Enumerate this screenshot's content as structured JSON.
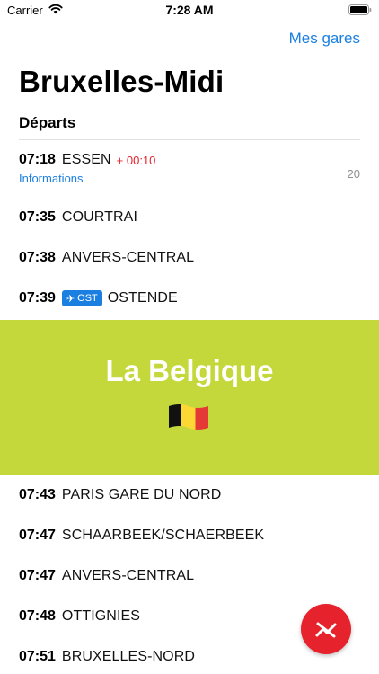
{
  "status_bar": {
    "carrier": "Carrier",
    "time": "7:28 AM"
  },
  "nav": {
    "right_link": "Mes gares"
  },
  "station": {
    "name": "Bruxelles-Midi"
  },
  "section": {
    "title": "Départs"
  },
  "departures": [
    {
      "time": "07:18",
      "destination": "ESSEN",
      "delay": "+ 00:10",
      "platform": "20",
      "info": "Informations"
    },
    {
      "time": "07:35",
      "destination": "COURTRAI"
    },
    {
      "time": "07:38",
      "destination": "ANVERS-CENTRAL"
    },
    {
      "time": "07:39",
      "destination": "OSTENDE",
      "badge": "OST",
      "badge_icon": "airplane-icon"
    },
    {
      "time": "07:43",
      "destination": "PARIS GARE DU NORD"
    },
    {
      "time": "07:47",
      "destination": "SCHAARBEEK/SCHAERBEEK"
    },
    {
      "time": "07:47",
      "destination": "ANVERS-CENTRAL"
    },
    {
      "time": "07:48",
      "destination": "OTTIGNIES"
    },
    {
      "time": "07:51",
      "destination": "BRUXELLES-NORD"
    }
  ],
  "banner": {
    "title": "La Belgique",
    "icon": "belgian-flag-icon",
    "color": "#c4d83b"
  },
  "fab": {
    "icon": "no-connection-icon",
    "color": "#e6232d"
  },
  "colors": {
    "accent": "#1a7fe0",
    "delay": "#e8202a",
    "badge": "#1a7fe0"
  }
}
